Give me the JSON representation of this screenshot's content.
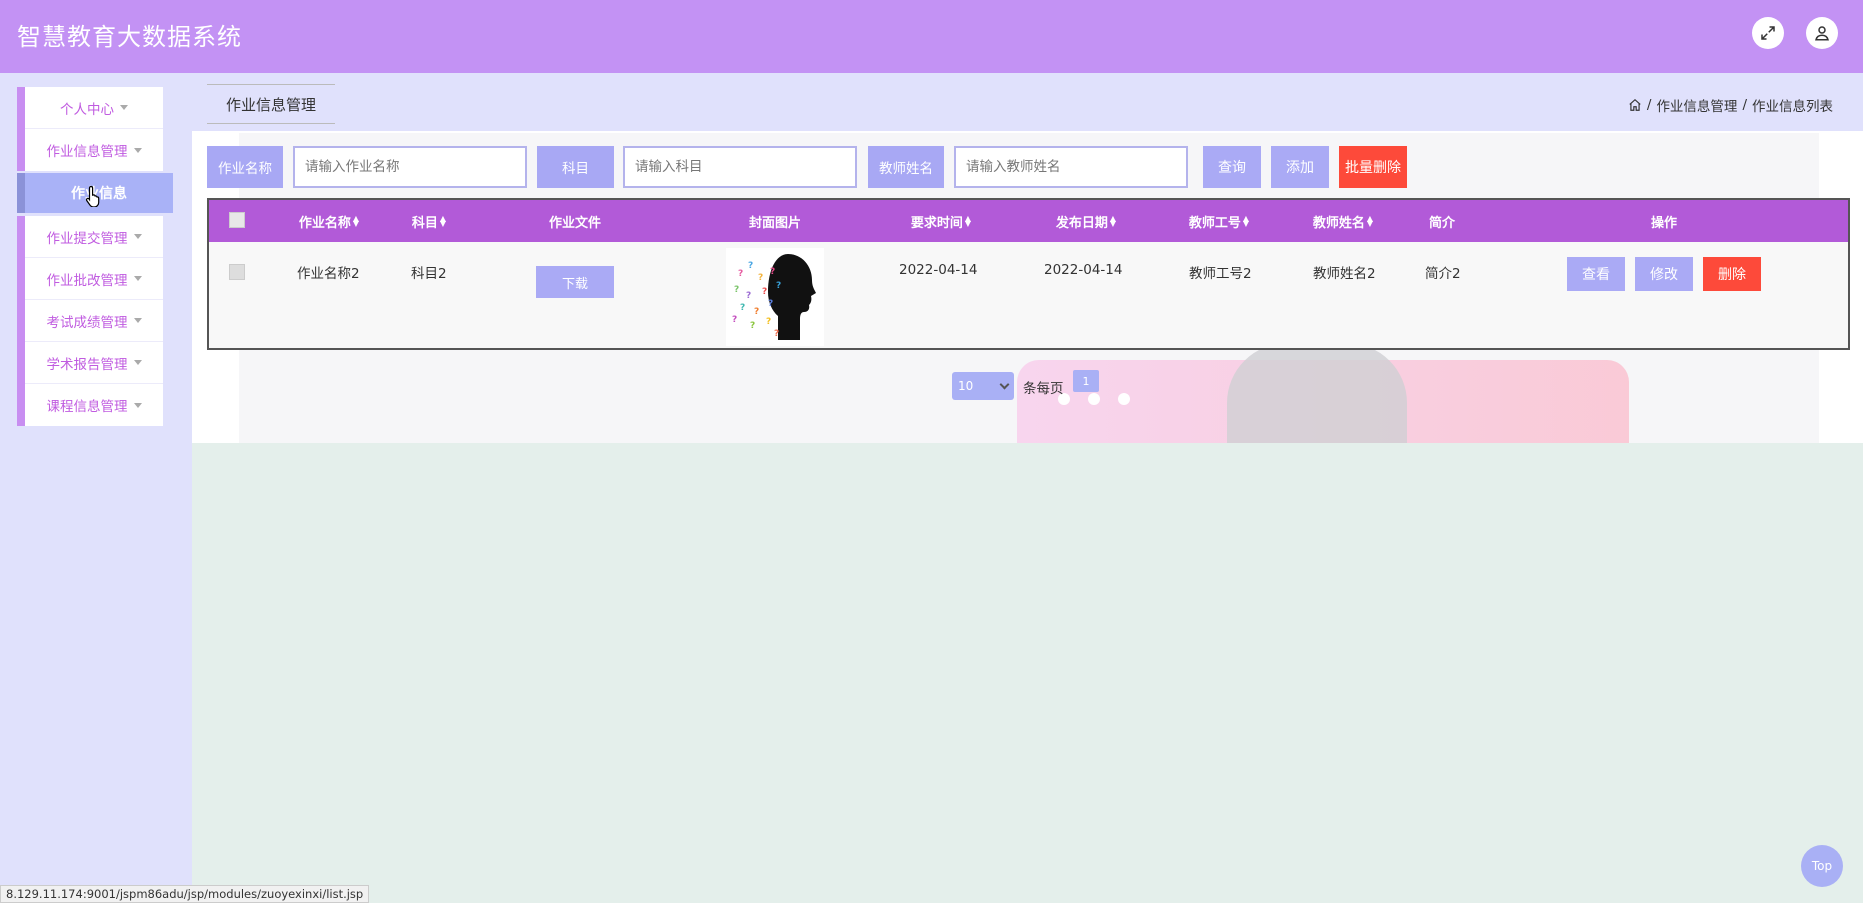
{
  "app": {
    "title": "智慧教育大数据系统"
  },
  "header": {
    "fullscreen_icon": "expand-icon",
    "user_icon": "user-icon"
  },
  "sidebar": {
    "groups": [
      {
        "label": "个人中心"
      },
      {
        "label": "作业信息管理",
        "sub": "作业信息"
      },
      {
        "label": "作业提交管理"
      },
      {
        "label": "作业批改管理"
      },
      {
        "label": "考试成绩管理"
      },
      {
        "label": "学术报告管理"
      },
      {
        "label": "课程信息管理"
      }
    ]
  },
  "tab": {
    "label": "作业信息管理"
  },
  "breadcrumb": {
    "home_icon": "home-icon",
    "sep": "/",
    "level1": "作业信息管理",
    "level2": "作业信息列表"
  },
  "search": {
    "name_label": "作业名称",
    "name_placeholder": "请输入作业名称",
    "subject_label": "科目",
    "subject_placeholder": "请输入科目",
    "teacher_label": "教师姓名",
    "teacher_placeholder": "请输入教师姓名",
    "query": "查询",
    "add": "添加",
    "batch_delete": "批量删除"
  },
  "table": {
    "headers": [
      "作业名称",
      "科目",
      "作业文件",
      "封面图片",
      "要求时间",
      "发布日期",
      "教师工号",
      "教师姓名",
      "简介",
      "操作"
    ],
    "rows": [
      {
        "name": "作业名称2",
        "subject": "科目2",
        "file_button": "下载",
        "required_time": "2022-04-14",
        "publish_date": "2022-04-14",
        "teacher_id": "教师工号2",
        "teacher_name": "教师姓名2",
        "intro": "简介2",
        "view": "查看",
        "edit": "修改",
        "delete": "删除"
      }
    ]
  },
  "pagination": {
    "page_size": "10",
    "per_page_text": "条每页",
    "current_page": "1"
  },
  "back_to_top": "Top",
  "status_url": "8.129.11.174:9001/jspm86adu/jsp/modules/zuoyexinxi/list.jsp",
  "colors": {
    "header": "#c392f4",
    "sidebar_accent": "#c88ef1",
    "table_header": "#b25ad8",
    "button": "#aaaaf5",
    "danger": "#fd4a3a"
  }
}
